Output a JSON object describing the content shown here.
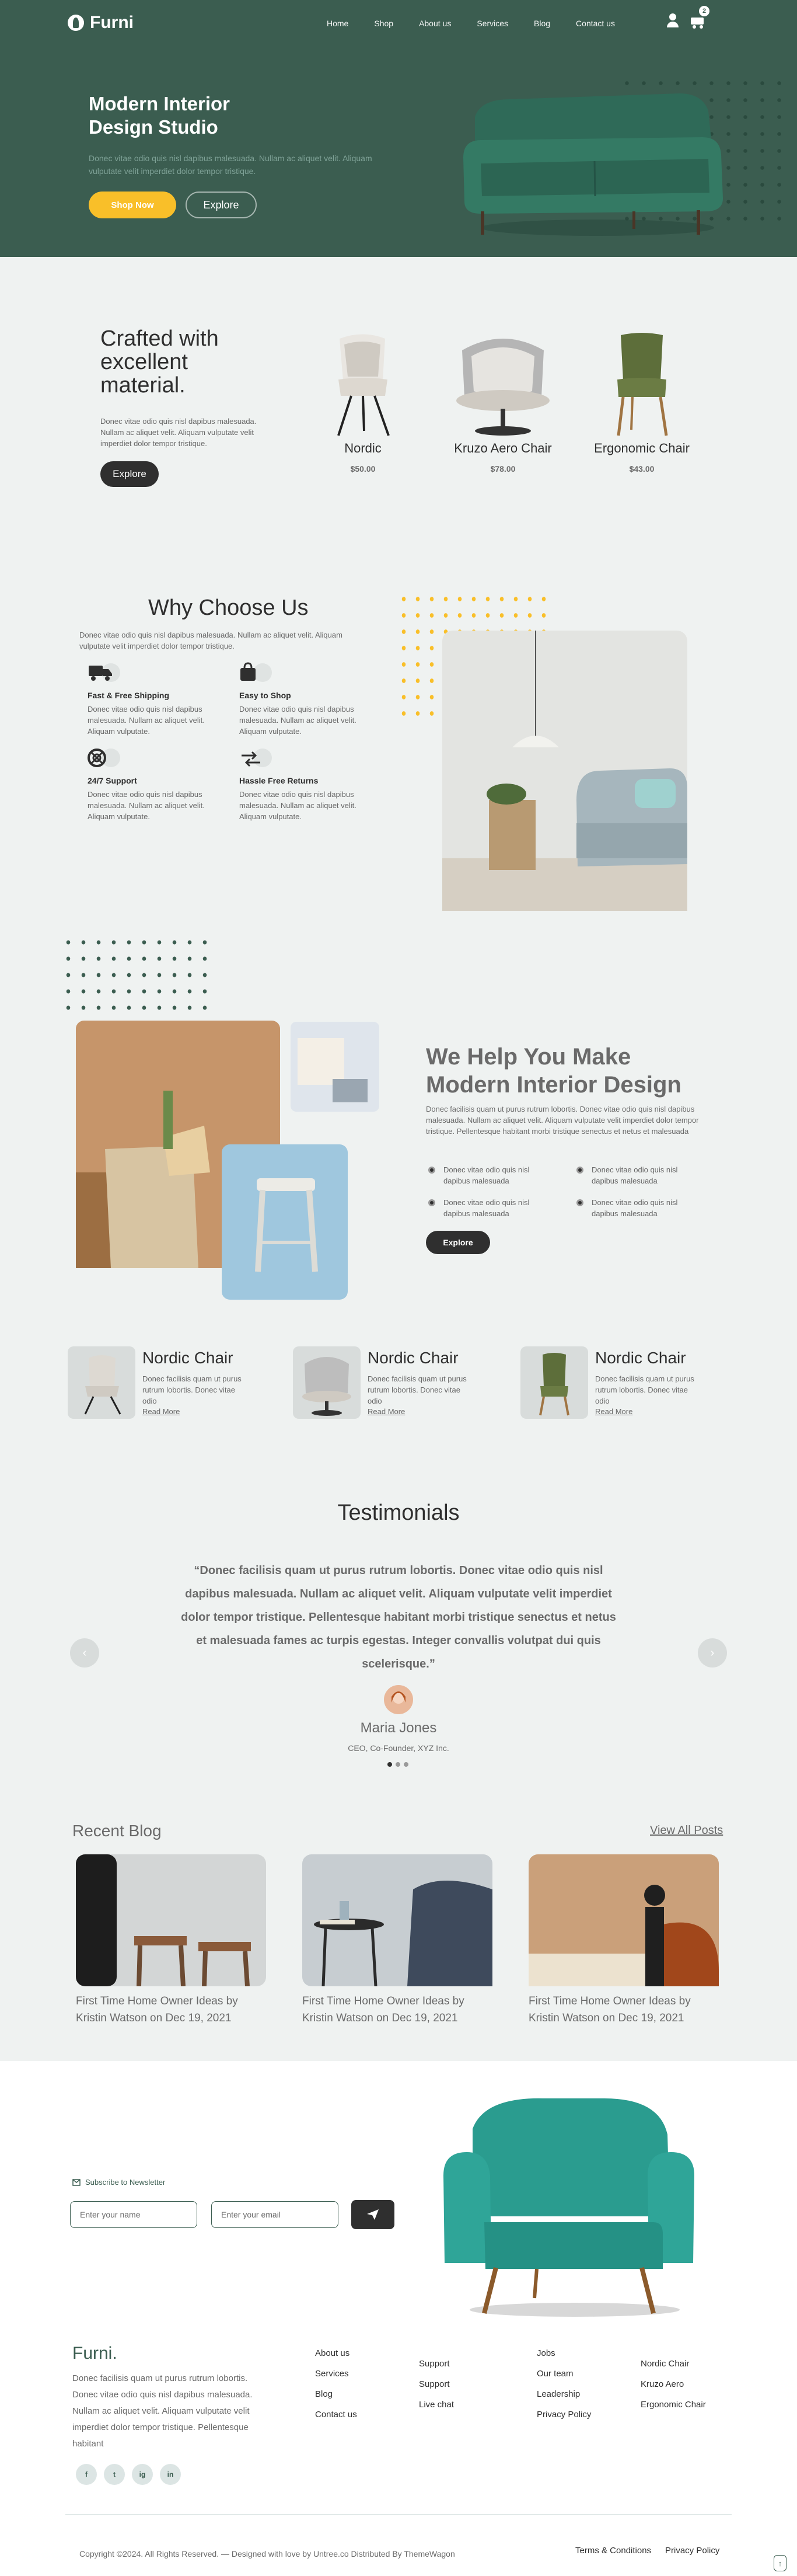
{
  "header": {
    "brand": "Furni",
    "nav": [
      "Home",
      "Shop",
      "About us",
      "Services",
      "Blog",
      "Contact us"
    ],
    "cart_count": "2"
  },
  "hero": {
    "title": "Modern Interior Design Studio",
    "description": "Donec vitae odio quis nisl dapibus malesuada. Nullam ac aliquet velit. Aliquam vulputate velit imperdiet dolor tempor tristique.",
    "shop_label": "Shop Now",
    "explore_label": "Explore"
  },
  "product_section": {
    "title": "Crafted with excellent material.",
    "description": "Donec vitae odio quis nisl dapibus malesuada. Nullam ac aliquet velit. Aliquam vulputate velit imperdiet dolor tempor tristique.",
    "explore_label": "Explore",
    "products": [
      {
        "name": "Nordic",
        "price": "$50.00"
      },
      {
        "name": "Kruzo Aero Chair",
        "price": "$78.00"
      },
      {
        "name": "Ergonomic Chair",
        "price": "$43.00"
      }
    ]
  },
  "why": {
    "title": "Why Choose Us",
    "description": "Donec vitae odio quis nisl dapibus malesuada. Nullam ac aliquet velit. Aliquam vulputate velit imperdiet dolor tempor tristique.",
    "features": [
      {
        "title": "Fast & Free Shipping",
        "text": "Donec vitae odio quis nisl dapibus malesuada. Nullam ac aliquet velit. Aliquam vulputate.",
        "icon": "truck-icon"
      },
      {
        "title": "Easy to Shop",
        "text": "Donec vitae odio quis nisl dapibus malesuada. Nullam ac aliquet velit. Aliquam vulputate.",
        "icon": "bag-icon"
      },
      {
        "title": "24/7 Support",
        "text": "Donec vitae odio quis nisl dapibus malesuada. Nullam ac aliquet velit. Aliquam vulputate.",
        "icon": "support-icon"
      },
      {
        "title": "Hassle Free Returns",
        "text": "Donec vitae odio quis nisl dapibus malesuada. Nullam ac aliquet velit. Aliquam vulputate.",
        "icon": "return-icon"
      }
    ]
  },
  "help": {
    "title": "We Help You Make Modern Interior Design",
    "description": "Donec facilisis quam ut purus rutrum lobortis. Donec vitae odio quis nisl dapibus malesuada. Nullam ac aliquet velit. Aliquam vulputate velit imperdiet dolor tempor tristique. Pellentesque habitant morbi tristique senectus et netus et malesuada",
    "bullets": [
      "Donec vitae odio quis nisl dapibus malesuada",
      "Donec vitae odio quis nisl dapibus malesuada",
      "Donec vitae odio quis nisl dapibus malesuada",
      "Donec vitae odio quis nisl dapibus malesuada"
    ],
    "explore_label": "Explore"
  },
  "popular": [
    {
      "name": "Nordic Chair",
      "text": "Donec facilisis quam ut purus rutrum lobortis. Donec vitae odio",
      "link": "Read More"
    },
    {
      "name": "Nordic Chair",
      "text": "Donec facilisis quam ut purus rutrum lobortis. Donec vitae odio",
      "link": "Read More"
    },
    {
      "name": "Nordic Chair",
      "text": "Donec facilisis quam ut purus rutrum lobortis. Donec vitae odio",
      "link": "Read More"
    }
  ],
  "testimonials": {
    "title": "Testimonials",
    "quote": "“Donec facilisis quam ut purus rutrum lobortis. Donec vitae odio quis nisl dapibus malesuada. Nullam ac aliquet velit. Aliquam vulputate velit imperdiet dolor tempor tristique. Pellentesque habitant morbi tristique senectus et netus et malesuada fames ac turpis egestas. Integer convallis volutpat dui quis scelerisque.”",
    "name": "Maria Jones",
    "role": "CEO, Co-Founder, XYZ Inc."
  },
  "blog": {
    "title": "Recent Blog",
    "view_all": "View All Posts",
    "posts": [
      {
        "title": "First Time Home Owner Ideas by",
        "meta": "Kristin Watson on Dec 19, 2021"
      },
      {
        "title": "First Time Home Owner Ideas by",
        "meta": "Kristin Watson on Dec 19, 2021"
      },
      {
        "title": "First Time Home Owner Ideas by",
        "meta": "Kristin Watson on Dec 19, 2021"
      }
    ]
  },
  "newsletter": {
    "label": "Subscribe to Newsletter",
    "name_placeholder": "Enter your name",
    "email_placeholder": "Enter your email"
  },
  "footer": {
    "brand": "Furni.",
    "description": "Donec facilisis quam ut purus rutrum lobortis. Donec vitae odio quis nisl dapibus malesuada. Nullam ac aliquet velit. Aliquam vulputate velit imperdiet dolor tempor tristique. Pellentesque habitant",
    "col1": [
      "About us",
      "Services",
      "Blog",
      "Contact us"
    ],
    "col2": [
      "Support",
      "Support",
      "Live chat"
    ],
    "col3": [
      "Jobs",
      "Our team",
      "Leadership",
      "Privacy Policy"
    ],
    "col4": [
      "Nordic Chair",
      "Kruzo Aero",
      "Ergonomic Chair"
    ],
    "social": [
      "f",
      "t",
      "ig",
      "in"
    ],
    "copyright": "Copyright ©2024. All Rights Reserved. — Designed with love by Untree.co Distributed By ThemeWagon",
    "terms": "Terms & Conditions",
    "privacy": "Privacy Policy"
  },
  "colors": {
    "primary": "#3b5d50",
    "accent": "#f9bf29",
    "background": "#eff2f1",
    "text": "#2f2f2f"
  }
}
